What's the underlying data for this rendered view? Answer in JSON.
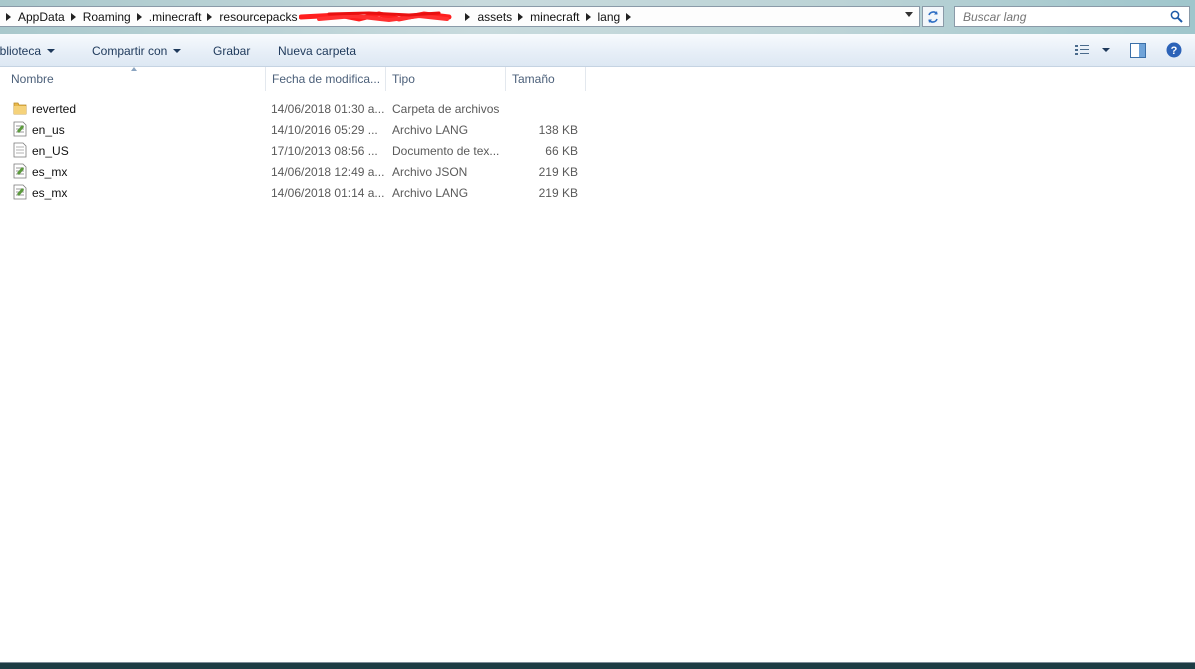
{
  "address": {
    "crumbs": [
      "AppData",
      "Roaming",
      ".minecraft",
      "resourcepacks",
      "assets",
      "minecraft",
      "lang"
    ]
  },
  "search": {
    "placeholder": "Buscar lang"
  },
  "toolbar": {
    "library": "iblioteca",
    "share": "Compartir con",
    "burn": "Grabar",
    "new_folder": "Nueva carpeta"
  },
  "columns": {
    "name": "Nombre",
    "date": "Fecha de modifica...",
    "type": "Tipo",
    "size": "Tamaño"
  },
  "files": [
    {
      "icon": "folder-icon",
      "name": "reverted",
      "date": "14/06/2018 01:30 a...",
      "type": "Carpeta de archivos",
      "size": ""
    },
    {
      "icon": "lang-file-icon",
      "name": "en_us",
      "date": "14/10/2016 05:29 ...",
      "type": "Archivo LANG",
      "size": "138 KB"
    },
    {
      "icon": "text-file-icon",
      "name": "en_US",
      "date": "17/10/2013 08:56 ...",
      "type": "Documento de tex...",
      "size": "66 KB"
    },
    {
      "icon": "json-file-icon",
      "name": "es_mx",
      "date": "14/06/2018 12:49 a...",
      "type": "Archivo JSON",
      "size": "219 KB"
    },
    {
      "icon": "lang-file-icon",
      "name": "es_mx",
      "date": "14/06/2018 01:14 a...",
      "type": "Archivo LANG",
      "size": "219 KB"
    }
  ],
  "colors": {
    "redaction": "#ff1e1e",
    "toolbar_text": "#1e395b"
  }
}
